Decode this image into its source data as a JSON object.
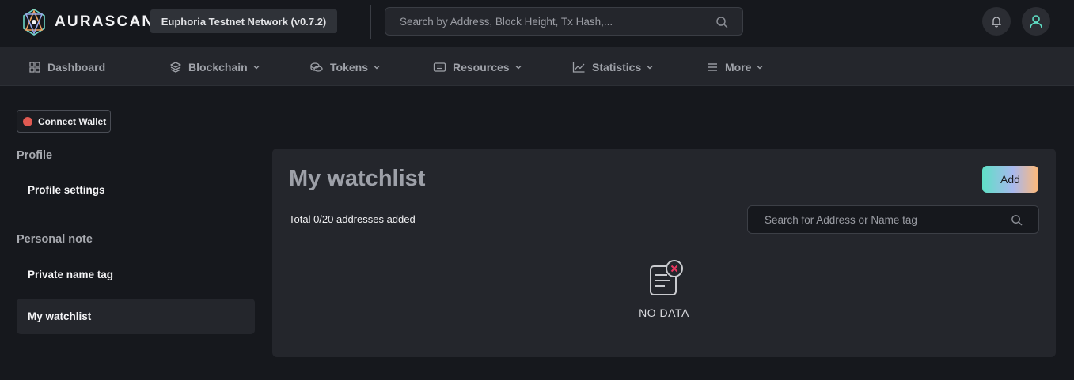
{
  "header": {
    "brand": "AURASCAN",
    "network": "Euphoria Testnet Network (v0.7.2)",
    "search_placeholder": "Search by Address, Block Height, Tx Hash,..."
  },
  "nav": {
    "items": [
      {
        "label": "Dashboard",
        "icon": "grid-icon"
      },
      {
        "label": "Blockchain",
        "icon": "layers-icon"
      },
      {
        "label": "Tokens",
        "icon": "coins-icon"
      },
      {
        "label": "Resources",
        "icon": "document-icon"
      },
      {
        "label": "Statistics",
        "icon": "chart-icon"
      },
      {
        "label": "More",
        "icon": "menu-icon"
      }
    ]
  },
  "sidebar": {
    "connect_wallet": "Connect Wallet",
    "profile_title": "Profile",
    "profile_settings": "Profile settings",
    "note_title": "Personal note",
    "private_name_tag": "Private name tag",
    "my_watchlist": "My watchlist"
  },
  "main": {
    "title": "My watchlist",
    "add_label": "Add",
    "total_text": "Total 0/20 addresses added",
    "search_placeholder": "Search for Address or Name tag",
    "empty_text": "NO DATA"
  },
  "colors": {
    "background": "#16181d",
    "card": "#24262c",
    "accent_start": "#5fe0c6",
    "accent_end": "#ffb978",
    "wallet_dot": "#e05a52",
    "empty_x": "#e8375f"
  }
}
